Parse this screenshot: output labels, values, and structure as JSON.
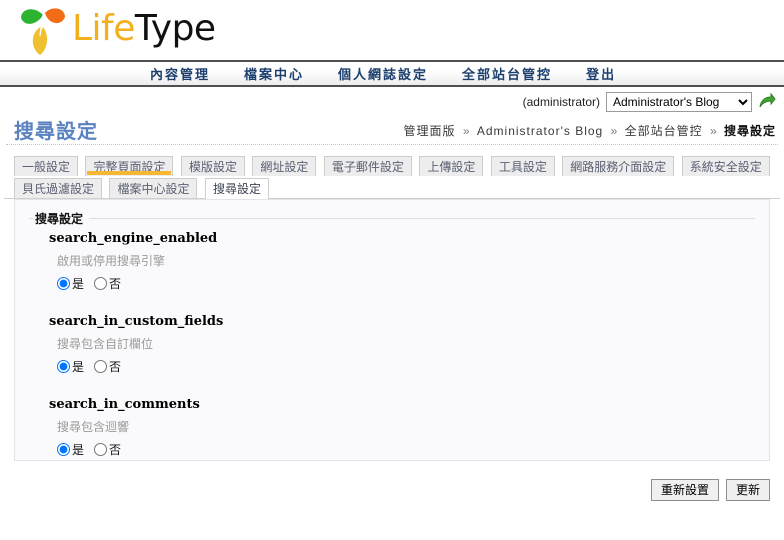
{
  "branding": {
    "name_part1": "Life",
    "name_part2": "Type",
    "color_accent": "#f2b01e",
    "logo_icon": "three-leaf-icon",
    "leaf_green": "#2cb332",
    "leaf_orange": "#f26c16",
    "leaf_yellow": "#f0c030"
  },
  "main_nav": {
    "items": [
      {
        "label": "內容管理"
      },
      {
        "label": "檔案中心"
      },
      {
        "label": "個人網誌設定"
      },
      {
        "label": "全部站台管控"
      },
      {
        "label": "登出"
      }
    ]
  },
  "identity": {
    "user": "(administrator)",
    "blog_selected": "Administrator's Blog",
    "blog_options": [
      "Administrator's Blog"
    ],
    "go_icon": "green-curved-arrow-icon"
  },
  "header": {
    "page_title": "搜尋設定"
  },
  "breadcrumb": {
    "items": [
      "管理面版",
      "Administrator's Blog",
      "全部站台管控"
    ],
    "current": "搜尋設定",
    "separator": "»"
  },
  "tabs": {
    "items": [
      {
        "label": "一般設定",
        "state": "normal"
      },
      {
        "label": "完整頁面設定",
        "state": "hover"
      },
      {
        "label": "模版設定",
        "state": "normal"
      },
      {
        "label": "網址設定",
        "state": "normal"
      },
      {
        "label": "電子郵件設定",
        "state": "normal"
      },
      {
        "label": "上傳設定",
        "state": "normal"
      },
      {
        "label": "工具設定",
        "state": "normal"
      },
      {
        "label": "網路服務介面設定",
        "state": "normal"
      },
      {
        "label": "系統安全設定",
        "state": "normal"
      },
      {
        "label": "貝氏過濾設定",
        "state": "normal"
      },
      {
        "label": "檔案中心設定",
        "state": "normal"
      },
      {
        "label": "搜尋設定",
        "state": "active"
      }
    ]
  },
  "panel": {
    "legend": "搜尋設定",
    "fields": [
      {
        "name": "search_engine_enabled",
        "description": "啟用或停用搜尋引擎",
        "options": [
          {
            "label": "是",
            "checked": true
          },
          {
            "label": "否",
            "checked": false
          }
        ]
      },
      {
        "name": "search_in_custom_fields",
        "description": "搜尋包含自訂欄位",
        "options": [
          {
            "label": "是",
            "checked": true
          },
          {
            "label": "否",
            "checked": false
          }
        ]
      },
      {
        "name": "search_in_comments",
        "description": "搜尋包含迴響",
        "options": [
          {
            "label": "是",
            "checked": true
          },
          {
            "label": "否",
            "checked": false
          }
        ]
      }
    ]
  },
  "footer": {
    "reset_label": "重新設置",
    "update_label": "更新"
  }
}
